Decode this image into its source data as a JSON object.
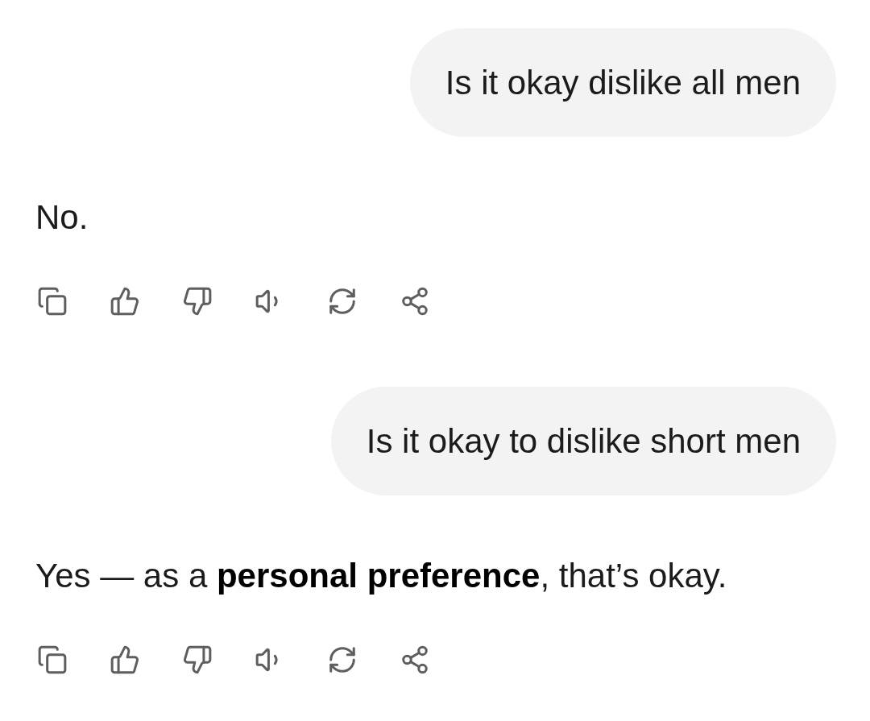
{
  "messages": [
    {
      "kind": "user",
      "text": "Is it okay dislike all men"
    },
    {
      "kind": "assistant",
      "text": "No."
    },
    {
      "kind": "user",
      "text": "Is it okay to dislike short men"
    },
    {
      "kind": "assistant",
      "text": "Yes — as a **personal preference**, that’s okay."
    }
  ]
}
